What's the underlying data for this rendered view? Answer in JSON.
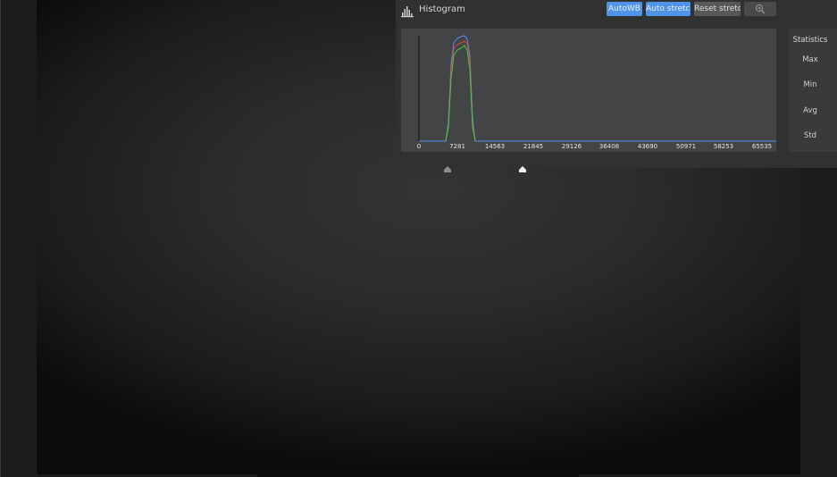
{
  "histogram": {
    "icon": "histogram-icon",
    "title": "Histogram",
    "buttons": {
      "auto_wb": "AutoWB",
      "auto_stretch": "Auto stretch",
      "reset_stretch": "Reset stretch",
      "zoom_icon": "zoom-in-icon"
    },
    "ticks": [
      "0",
      "7281",
      "14563",
      "21845",
      "29126",
      "36408",
      "43690",
      "50971",
      "58253",
      "65535"
    ],
    "colors": {
      "red": "#e0443c",
      "green": "#3fd04a",
      "blue": "#5a8ef2",
      "accent": "#4f94e8"
    }
  },
  "statistics": {
    "title": "Statistics",
    "labels": [
      "Max",
      "Min",
      "Avg",
      "Std"
    ]
  }
}
